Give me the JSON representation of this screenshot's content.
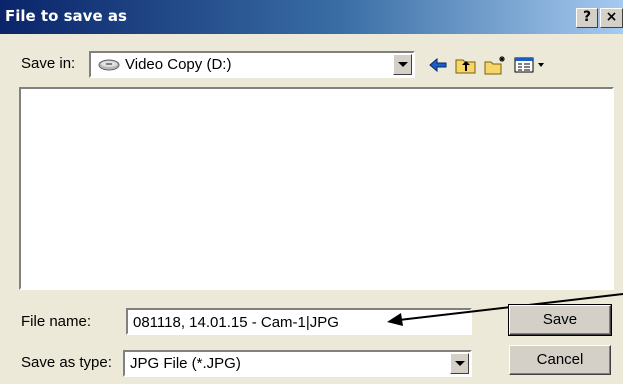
{
  "window": {
    "title": "File to save as",
    "help_label": "?",
    "close_label": "×"
  },
  "save_in": {
    "label": "Save in:",
    "value": "Video Copy (D:)"
  },
  "toolbar": {
    "icons": [
      "back-arrow-icon",
      "up-folder-icon",
      "new-folder-icon",
      "view-menu-icon"
    ]
  },
  "file_name": {
    "label": "File name:",
    "value": "081118, 14.01.15 - Cam-1|JPG"
  },
  "save_as_type": {
    "label": "Save as type:",
    "value": "JPG File (*.JPG)"
  },
  "buttons": {
    "save": "Save",
    "cancel": "Cancel"
  },
  "colors": {
    "titlebar_start": "#0a246a",
    "titlebar_end": "#a6caf0",
    "dialog_bg": "#ece9d8"
  }
}
